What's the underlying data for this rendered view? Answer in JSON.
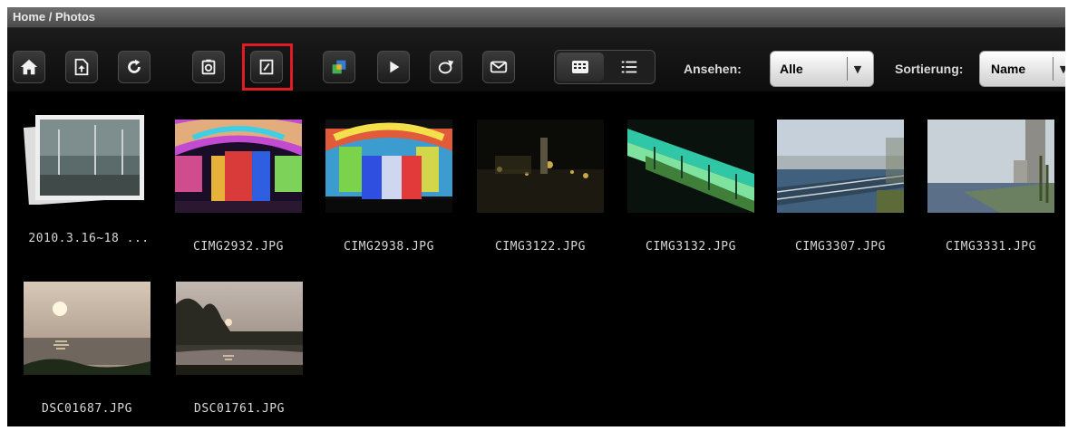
{
  "breadcrumb": "Home / Photos",
  "toolbar": {
    "buttons": [
      "home-icon",
      "upload-icon",
      "refresh-icon",
      "camera-icon",
      "edit-icon",
      "slideshow-cube-icon",
      "play-icon",
      "share-icon",
      "mail-icon"
    ],
    "view_modes": [
      "grid-view-icon",
      "list-view-icon"
    ],
    "view_label": "Ansehen:",
    "view_value": "Alle",
    "sort_label": "Sortierung:",
    "sort_value": "Name"
  },
  "accent": "#e11b24",
  "items": [
    {
      "name": "2010.3.16~18 ...",
      "type": "album"
    },
    {
      "name": "CIMG2932.JPG",
      "type": "photo"
    },
    {
      "name": "CIMG2938.JPG",
      "type": "photo"
    },
    {
      "name": "CIMG3122.JPG",
      "type": "photo"
    },
    {
      "name": "CIMG3132.JPG",
      "type": "photo"
    },
    {
      "name": "CIMG3307.JPG",
      "type": "photo"
    },
    {
      "name": "CIMG3331.JPG",
      "type": "photo"
    },
    {
      "name": "DSC01687.JPG",
      "type": "photo"
    },
    {
      "name": "DSC01761.JPG",
      "type": "photo"
    }
  ]
}
